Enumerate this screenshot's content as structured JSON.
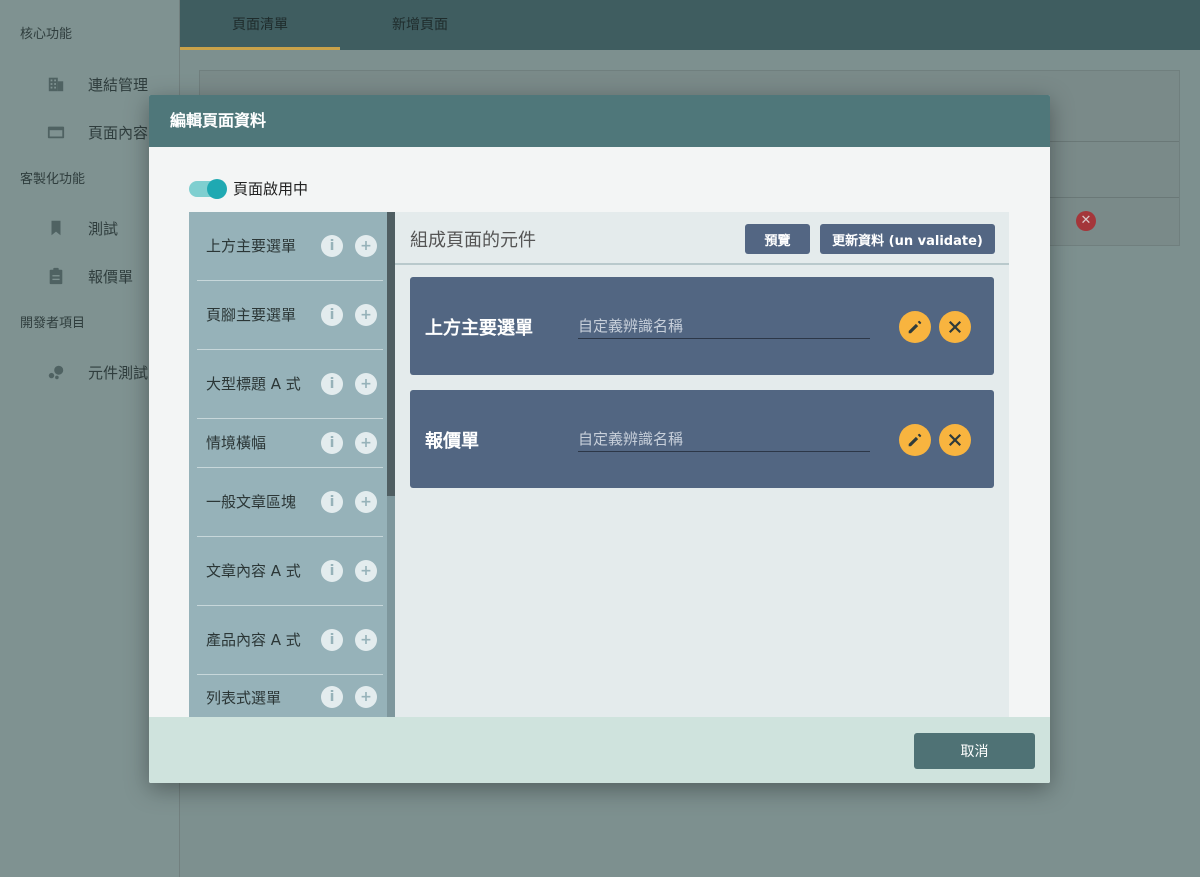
{
  "sidebar": {
    "sections": [
      {
        "label": "核心功能"
      },
      {
        "label": "客製化功能"
      },
      {
        "label": "開發者項目"
      }
    ],
    "items": [
      {
        "label": "連結管理",
        "icon": "building-icon"
      },
      {
        "label": "頁面內容",
        "icon": "window-icon"
      },
      {
        "label": "測試",
        "icon": "bookmark-icon"
      },
      {
        "label": "報價單",
        "icon": "clipboard-icon"
      },
      {
        "label": "元件測試",
        "icon": "bubbles-icon"
      }
    ]
  },
  "topbar": {
    "tabs": [
      {
        "label": "頁面清單",
        "active": true
      },
      {
        "label": "新增頁面",
        "active": false
      }
    ]
  },
  "modal": {
    "title": "編輯頁面資料",
    "toggle_label": "頁面啟用中",
    "toggle_on": true,
    "components": [
      {
        "name": "上方主要選單"
      },
      {
        "name": "頁腳主要選單"
      },
      {
        "name": "大型標題 A 式"
      },
      {
        "name": "情境橫幅"
      },
      {
        "name": "一般文章區塊"
      },
      {
        "name": "文章內容 A 式"
      },
      {
        "name": "產品內容 A 式"
      },
      {
        "name": "列表式選單"
      }
    ],
    "panel": {
      "title": "組成頁面的元件",
      "preview_label": "預覽",
      "update_label": "更新資料 (un validate)",
      "blocks": [
        {
          "name": "上方主要選單",
          "input_placeholder": "自定義辨識名稱"
        },
        {
          "name": "報價單",
          "input_placeholder": "自定義辨識名稱"
        }
      ]
    },
    "cancel_label": "取消"
  },
  "colors": {
    "modal_header": "#4f777a",
    "accent_toggle": "#1fa9b2",
    "block_bg": "#526682",
    "action_yellow": "#f8b43f",
    "tab_underline": "#c9a24a"
  }
}
